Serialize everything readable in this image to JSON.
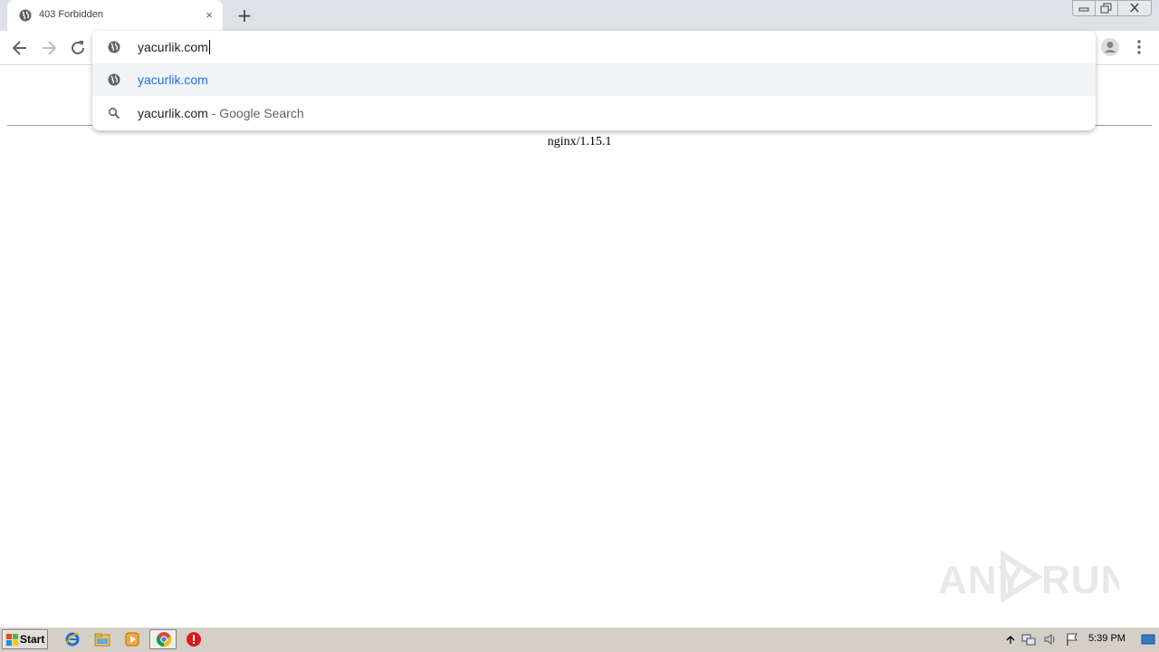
{
  "browser": {
    "tab": {
      "title": "403 Forbidden",
      "close_glyph": "×",
      "favicon": "globe-icon"
    },
    "new_tab_glyph": "+",
    "omnibox": {
      "input_value": "yacurlik.com",
      "suggestions": [
        {
          "icon": "globe-icon",
          "url": "yacurlik.com"
        },
        {
          "icon": "search-icon",
          "query": "yacurlik.com",
          "separator": " - ",
          "provider": "Google Search"
        }
      ]
    }
  },
  "page": {
    "footer": "nginx/1.15.1"
  },
  "watermark": {
    "text_left": "ANY",
    "text_right": "RUN"
  },
  "taskbar": {
    "start_label": "Start",
    "clock": "5:39 PM"
  },
  "colors": {
    "link_blue": "#1a73e8",
    "tabstrip": "#dee1e6",
    "taskbar": "#d4d0c8"
  }
}
